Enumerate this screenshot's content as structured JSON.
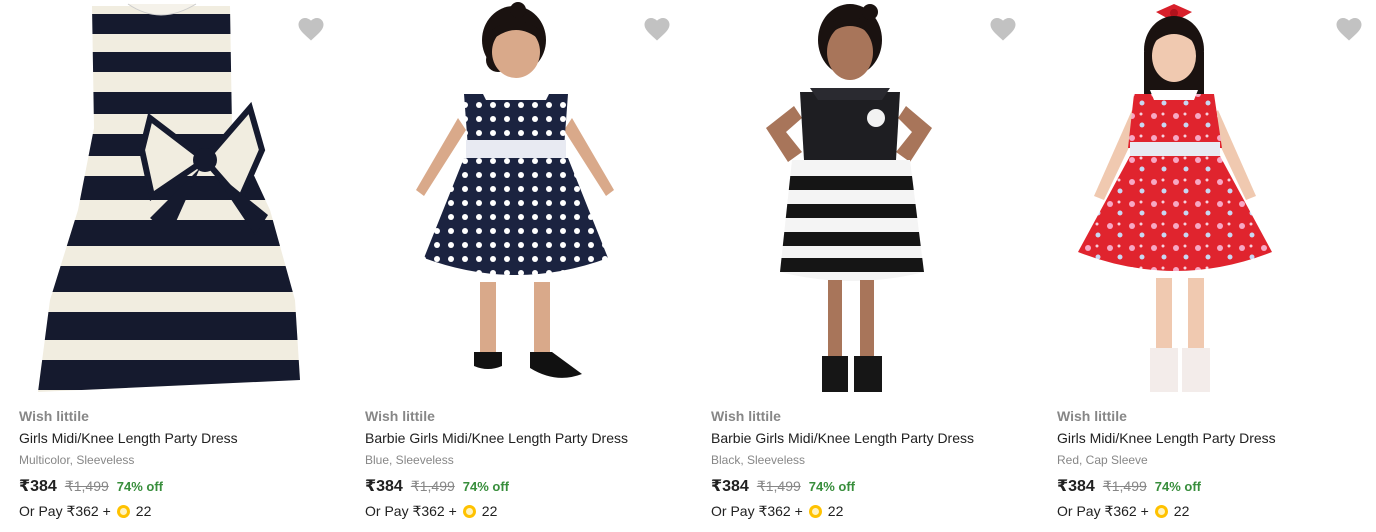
{
  "products": [
    {
      "brand": "Wish littile",
      "title": "Girls Midi/Knee Length Party Dress",
      "variant": "Multicolor, Sleeveless",
      "price": "₹384",
      "mrp": "₹1,499",
      "discount": "74% off",
      "pay_prefix": "Or Pay ₹362 +",
      "coins": "22",
      "image": "black-white-striped-bow-dress"
    },
    {
      "brand": "Wish littile",
      "title": "Barbie Girls Midi/Knee Length Party Dress",
      "variant": "Blue, Sleeveless",
      "price": "₹384",
      "mrp": "₹1,499",
      "discount": "74% off",
      "pay_prefix": "Or Pay ₹362 +",
      "coins": "22",
      "image": "navy-polka-dot-dress"
    },
    {
      "brand": "Wish littile",
      "title": "Barbie Girls Midi/Knee Length Party Dress",
      "variant": "Black, Sleeveless",
      "price": "₹384",
      "mrp": "₹1,499",
      "discount": "74% off",
      "pay_prefix": "Or Pay ₹362 +",
      "coins": "22",
      "image": "black-striped-satin-dress"
    },
    {
      "brand": "Wish littile",
      "title": "Girls Midi/Knee Length Party Dress",
      "variant": "Red, Cap Sleeve",
      "price": "₹384",
      "mrp": "₹1,499",
      "discount": "74% off",
      "pay_prefix": "Or Pay ₹362 +",
      "coins": "22",
      "image": "red-floral-dress"
    }
  ],
  "colors": {
    "brand_text": "#878787",
    "discount_green": "#388e3c",
    "wishlist_grey": "#c2c2c2",
    "coin_gold": "#ffc200"
  },
  "icons": {
    "wishlist": "heart-icon",
    "coin": "supercoin-icon"
  }
}
